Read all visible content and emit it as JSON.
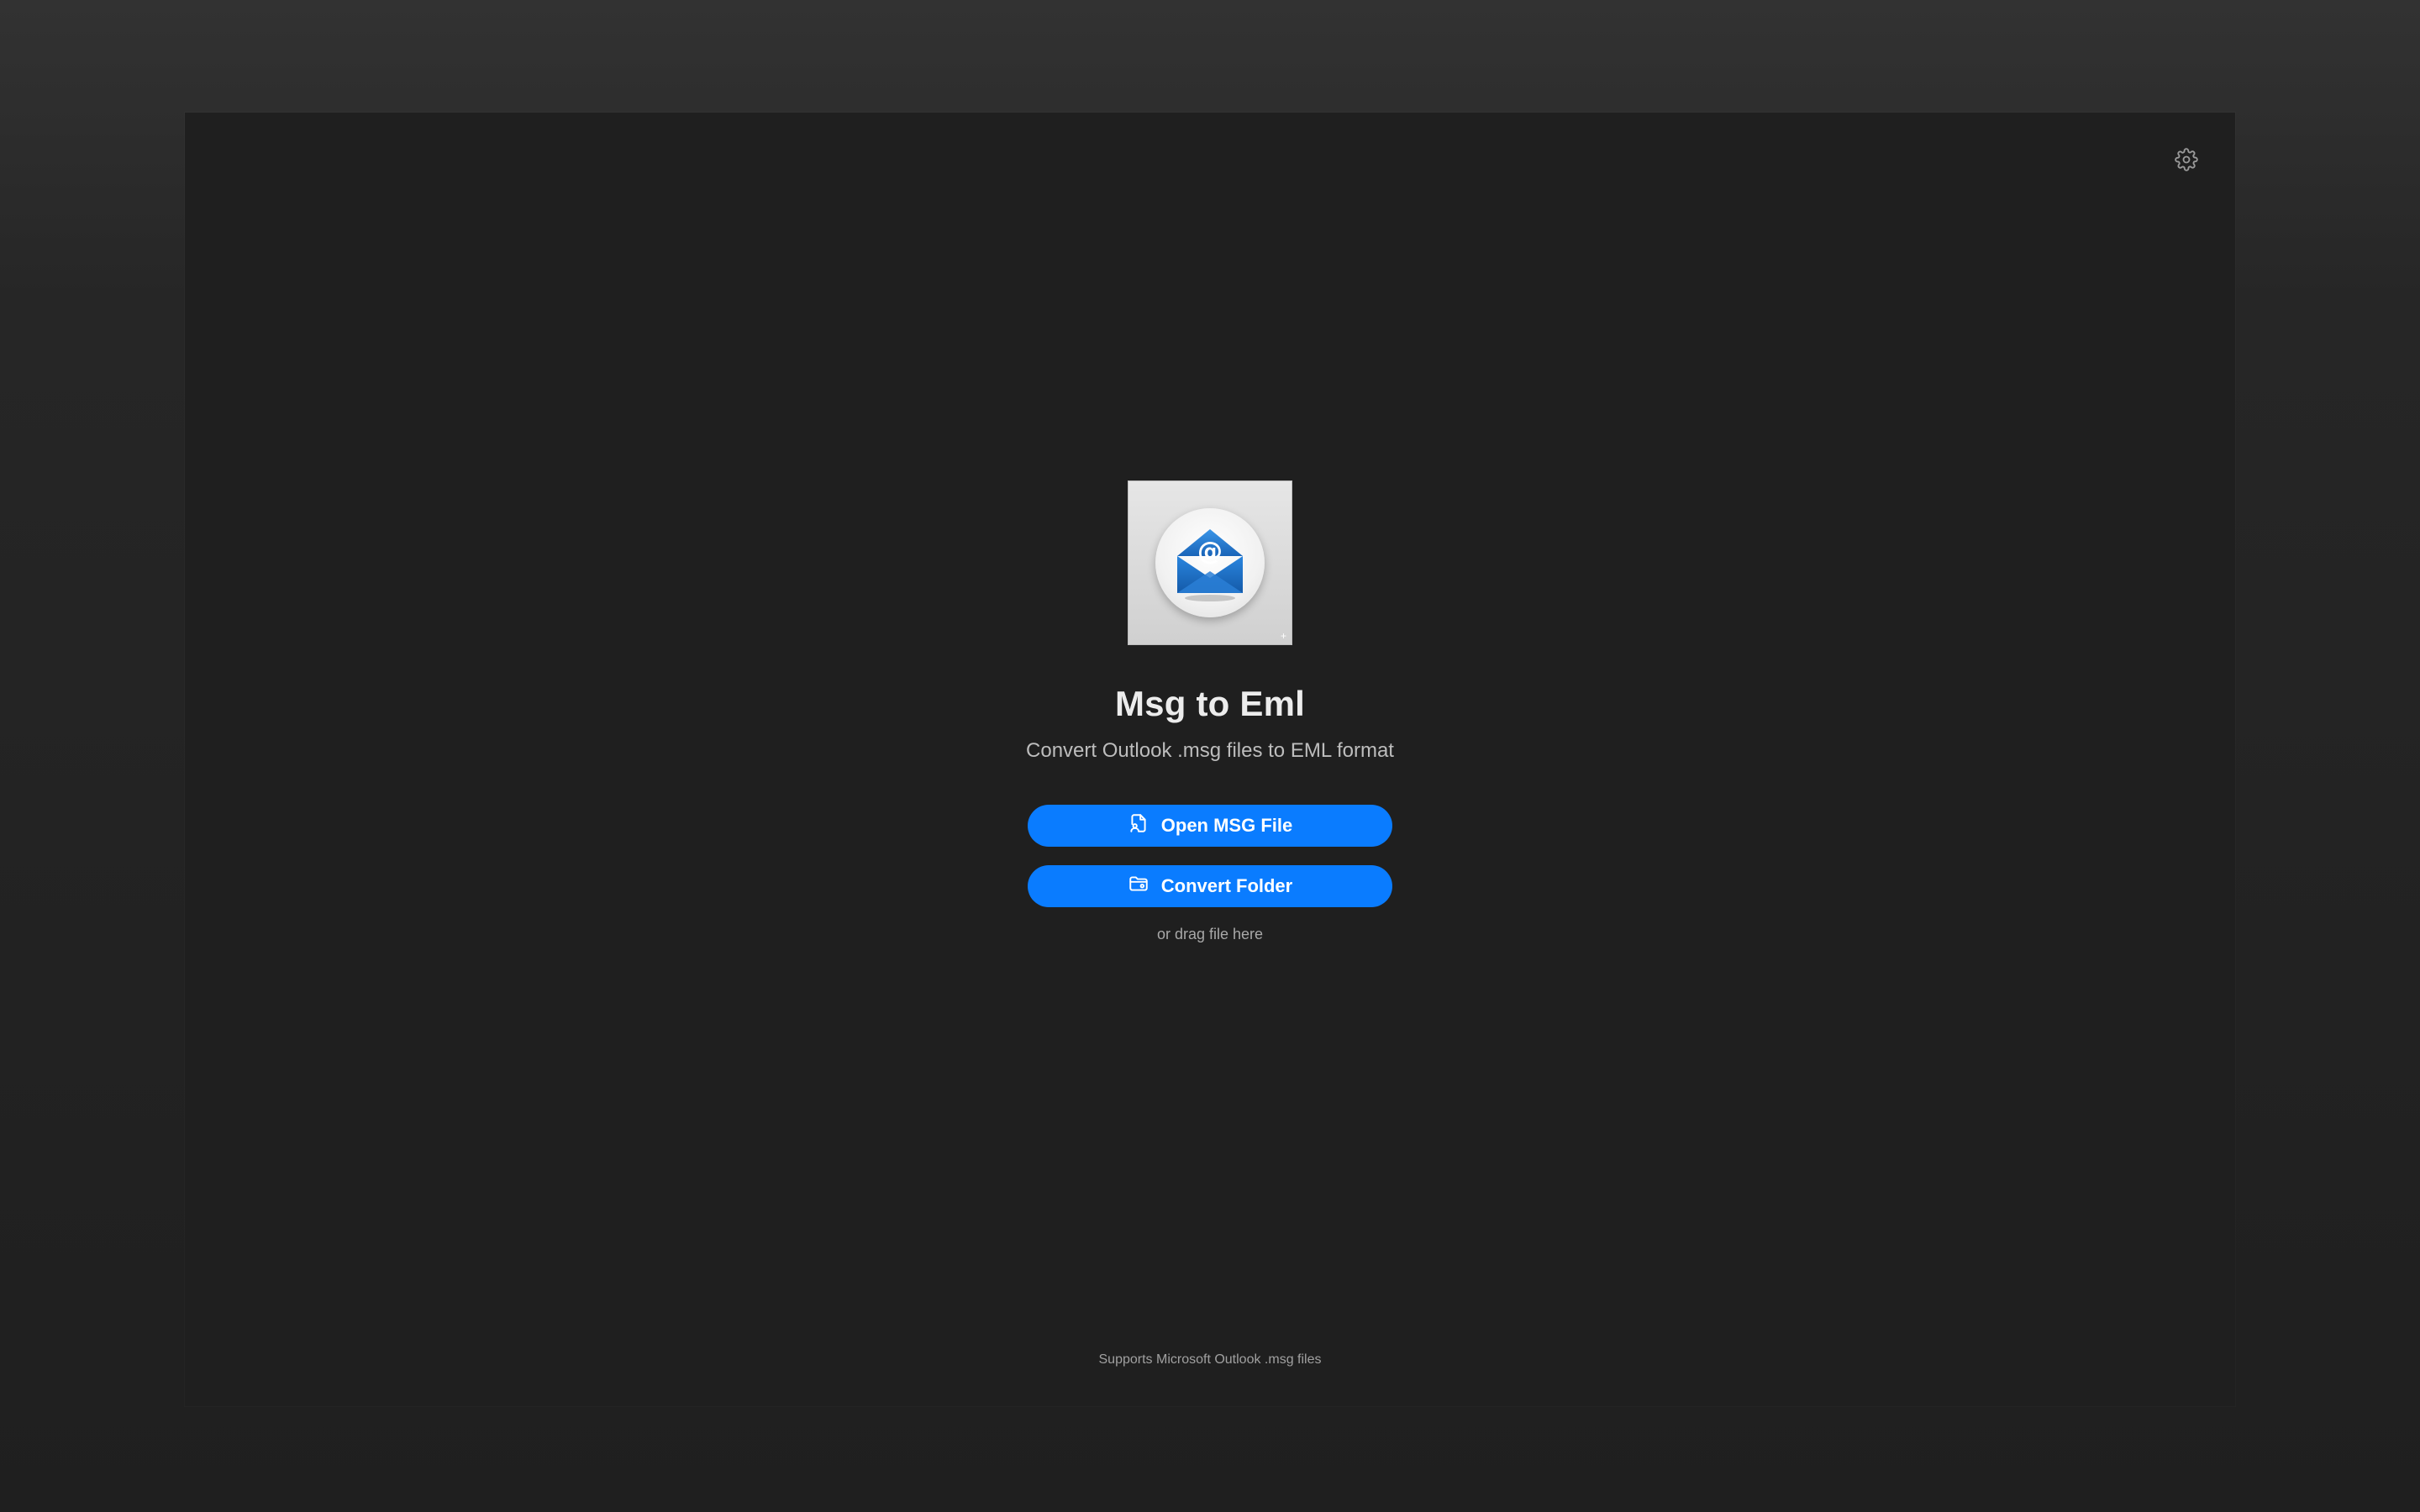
{
  "app": {
    "title": "Msg to Eml",
    "subtitle": "Convert Outlook .msg files to EML format"
  },
  "actions": {
    "open_label": "Open MSG File",
    "open_icon": "document-person-icon",
    "folder_label": "Convert Folder",
    "folder_icon": "folder-icon",
    "drag_hint": "or drag file here"
  },
  "toolbar": {
    "settings_icon": "gear-icon"
  },
  "footer": {
    "note": "Supports Microsoft Outlook .msg files"
  },
  "colors": {
    "accent": "#0a7cff",
    "background": "#1f1f1f",
    "icon_blue": "#1e73c8"
  },
  "icon": {
    "glyph": "@"
  }
}
